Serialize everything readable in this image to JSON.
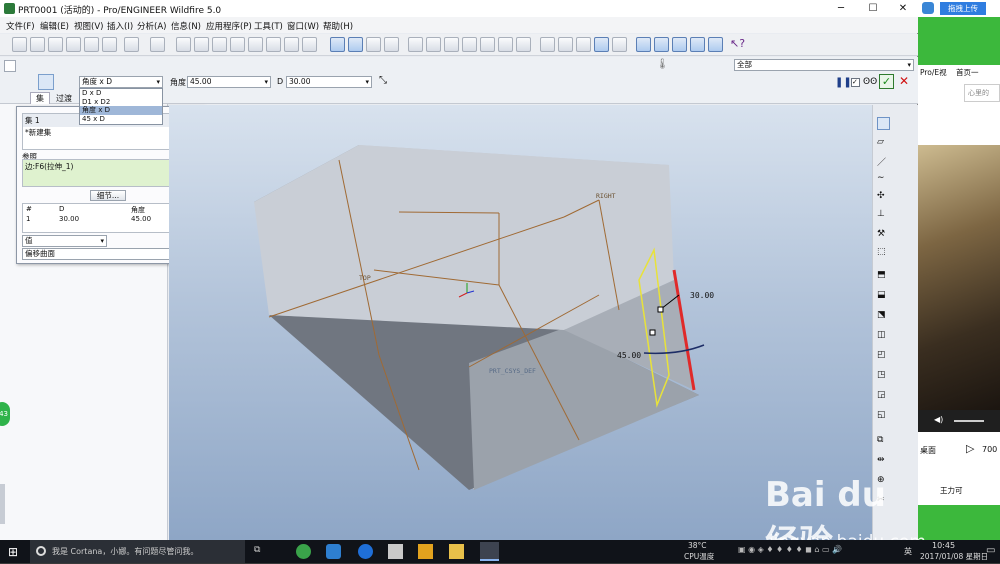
{
  "titlebar": {
    "title": "PRT0001 (活动的) - Pro/ENGINEER Wildfire 5.0"
  },
  "menu": [
    "文件(F)",
    "编辑(E)",
    "视图(V)",
    "插入(I)",
    "分析(A)",
    "信息(N)",
    "应用程序(P)",
    "工具(T)",
    "窗口(W)",
    "帮助(H)"
  ],
  "dashboard": {
    "mode_select": "角度 x D",
    "angle_label": "角度",
    "angle_value": "45.00",
    "d_label": "D",
    "d_value": "30.00",
    "mode_options": [
      "D x D",
      "D1 x D2",
      "角度 x D",
      "45 x D"
    ],
    "filter_select": "全部",
    "tabs": [
      "集",
      "过渡"
    ]
  },
  "set_panel": {
    "set_item": "集 1",
    "new_set": "*新建集",
    "refs_label": "参照",
    "ref_item": "边:F6(拉伸_1)",
    "details_button": "细节...",
    "table_headers": [
      "#",
      "D",
      "角度"
    ],
    "table_row": [
      "1",
      "30.00",
      "45.00"
    ],
    "value_select": "值",
    "offset_select": "偏移曲面"
  },
  "viewport": {
    "label_right": "RIGHT",
    "label_top": "TOP",
    "label_front": "PRT_CSYS_DEF",
    "dim_d": "30.00",
    "dim_angle": "45.00"
  },
  "browser": {
    "upload_button": "拖拽上传",
    "item1": "Pro/E视",
    "item2": "首页一",
    "search_placeholder": "心里的",
    "desktop": "桌面",
    "count": "700",
    "name": "王力可"
  },
  "taskbar": {
    "search": "我是 Cortana，小娜。有问题尽管问我。",
    "temp": "38°C",
    "cpu": "CPU温度",
    "time": "10:45",
    "date": "2017/01/08 星期日",
    "ime": "英"
  },
  "watermark": {
    "site": "jingyan.baidu.com",
    "brand": "Bai  du 经验"
  },
  "side_badge": "43"
}
